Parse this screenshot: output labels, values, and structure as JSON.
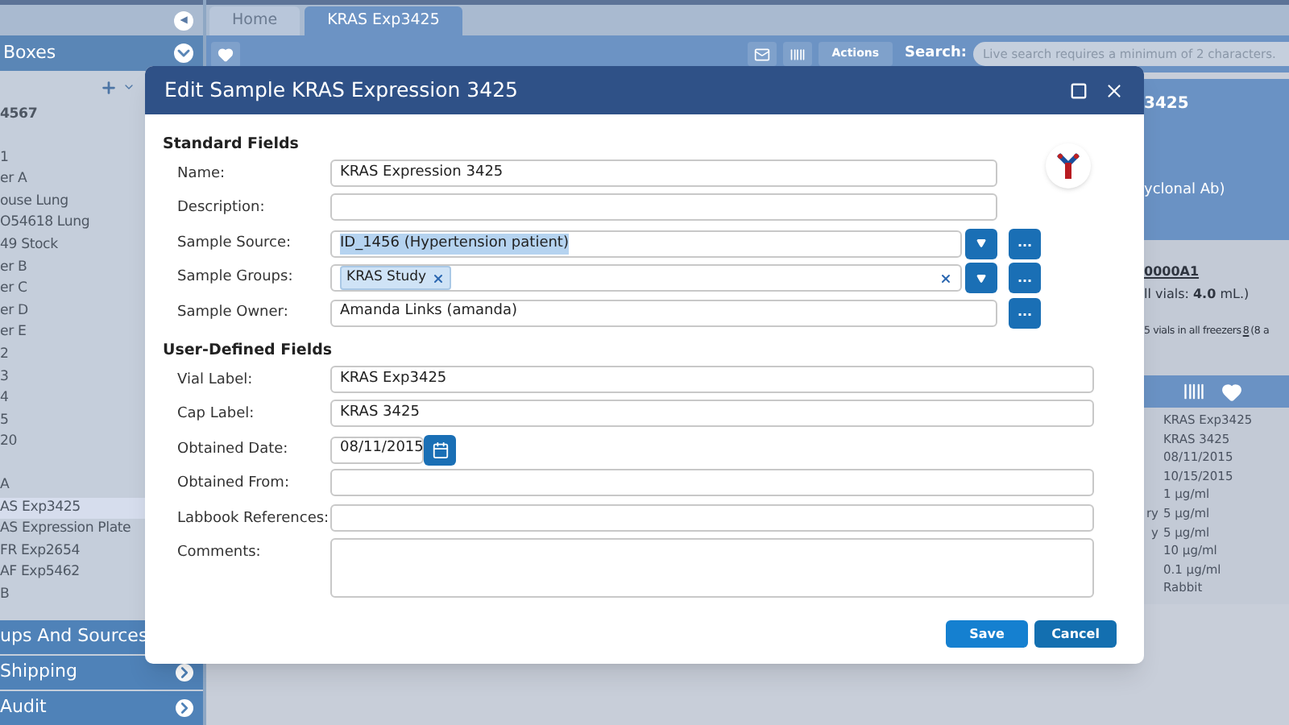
{
  "sidebar": {
    "collapse_icon": "◀",
    "header": "Boxes",
    "items": [
      {
        "label": "4567",
        "selected": false
      },
      {
        "label": "1",
        "selected": false
      },
      {
        "label": "er A",
        "selected": false
      },
      {
        "label": "ouse Lung",
        "selected": false
      },
      {
        "label": "O54618 Lung",
        "selected": false
      },
      {
        "label": "49 Stock",
        "selected": false
      },
      {
        "label": "er B",
        "selected": false
      },
      {
        "label": "er C",
        "selected": false
      },
      {
        "label": "er D",
        "selected": false
      },
      {
        "label": "er E",
        "selected": false
      },
      {
        "label": "2",
        "selected": false
      },
      {
        "label": "3",
        "selected": false
      },
      {
        "label": "4",
        "selected": false
      },
      {
        "label": "5",
        "selected": false
      },
      {
        "label": "20",
        "selected": false
      },
      {
        "label": "A",
        "selected": false
      },
      {
        "label": "AS Exp3425",
        "selected": true
      },
      {
        "label": "AS Expression Plate",
        "selected": false
      },
      {
        "label": "FR Exp2654",
        "selected": false
      },
      {
        "label": "AF Exp5462",
        "selected": false
      },
      {
        "label": "B",
        "selected": false
      }
    ],
    "sections": [
      {
        "label": "ups And Sources"
      },
      {
        "label": "Shipping",
        "arrow": true
      },
      {
        "label": "Audit",
        "arrow": true
      }
    ]
  },
  "tabs": [
    {
      "label": "Home",
      "selected": false
    },
    {
      "label": "KRAS Exp3425",
      "selected": true
    }
  ],
  "toolbar": {
    "actions": "Actions",
    "search_label": "Search:",
    "search_placeholder": "Live search requires a minimum of 2 characters."
  },
  "detail": {
    "title": "3425",
    "subtitle": "yclonal Ab)",
    "code": "0000A1",
    "vials": "ll vials: **4.0** mL.)",
    "freezers": "5 vials in all freezers",
    "freezers_link": "8",
    "freezers_tail": "(8 a",
    "rows": [
      {
        "value": "KRAS Exp3425"
      },
      {
        "value": "KRAS 3425"
      },
      {
        "value": "08/11/2015"
      },
      {
        "value": "10/15/2015"
      },
      {
        "value": "1 µg/ml"
      },
      {
        "label": "ry",
        "value": "5 µg/ml"
      },
      {
        "label": "y",
        "value": "5 µg/ml"
      },
      {
        "value": "10 µg/ml"
      },
      {
        "value": "0.1 µg/ml"
      },
      {
        "value": "Rabbit"
      }
    ]
  },
  "dialog": {
    "title": "Edit Sample KRAS Expression 3425",
    "sections": [
      {
        "heading": "Standard Fields",
        "fields": [
          {
            "kind": "text",
            "label": "Name:",
            "value": "KRAS Expression 3425"
          },
          {
            "kind": "text",
            "label": "Description:"
          },
          {
            "kind": "select",
            "label": "Sample Source:",
            "value": "ID_1456 (Hypertension patient)",
            "highlighted": true,
            "browse": "..."
          },
          {
            "kind": "tags",
            "label": "Sample Groups:",
            "tags": [
              "KRAS Study"
            ],
            "browse": "..."
          },
          {
            "kind": "lookup",
            "label": "Sample Owner:",
            "value": "Amanda Links (amanda)",
            "browse": "..."
          }
        ]
      },
      {
        "heading": "User-Defined Fields",
        "fields": [
          {
            "kind": "wide",
            "label": "Vial Label:",
            "value": "KRAS Exp3425"
          },
          {
            "kind": "wide",
            "label": "Cap Label:",
            "value": "KRAS 3425"
          },
          {
            "kind": "date",
            "label": "Obtained Date:",
            "value": "08/11/2015"
          },
          {
            "kind": "wide",
            "label": "Obtained From:"
          },
          {
            "kind": "wide",
            "label": "Labbook References:"
          },
          {
            "kind": "area",
            "label": "Comments:"
          }
        ]
      }
    ],
    "buttons": [
      {
        "label": "Save",
        "primary": true
      },
      {
        "label": "Cancel",
        "primary": false
      }
    ]
  }
}
